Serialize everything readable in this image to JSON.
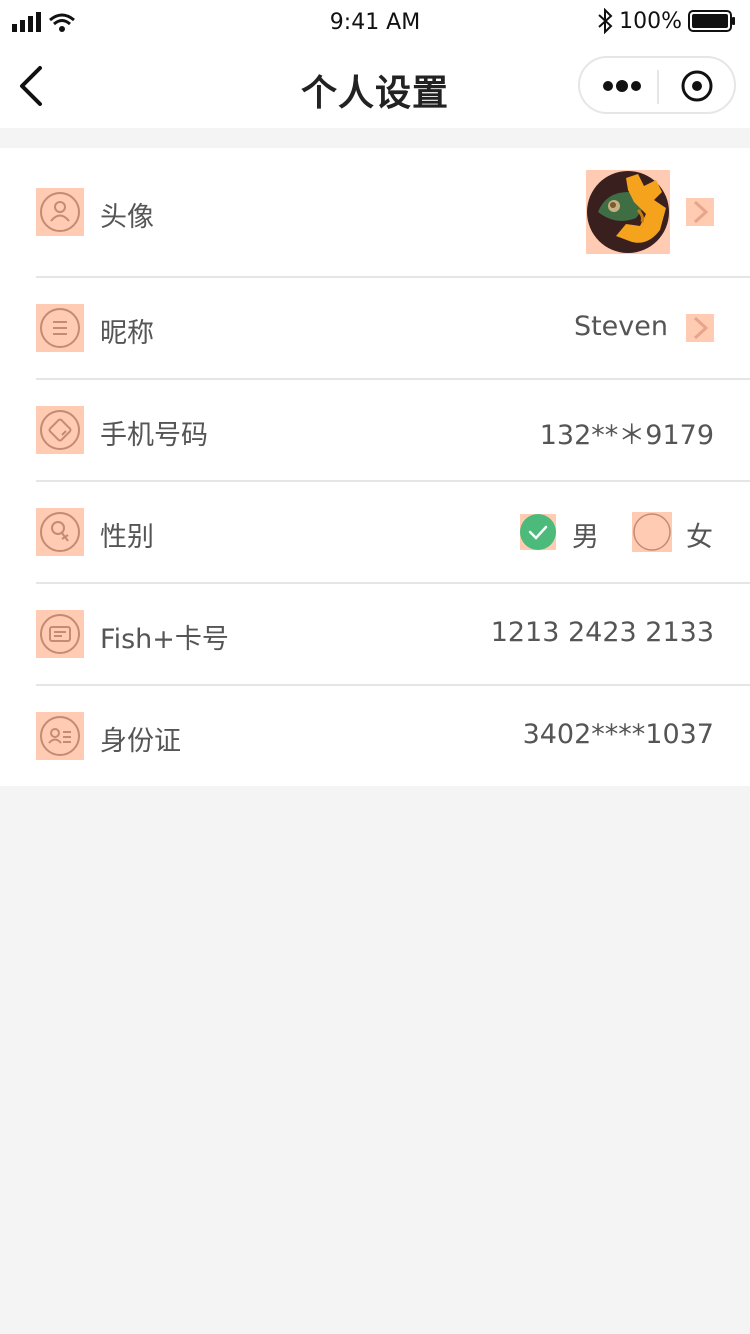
{
  "status_bar": {
    "time": "9:41 AM",
    "battery": "100%"
  },
  "nav": {
    "title": "个人设置"
  },
  "settings": {
    "avatar": {
      "label": "头像"
    },
    "nickname": {
      "label": "昵称",
      "value": "Steven"
    },
    "phone": {
      "label": "手机号码",
      "value": "132**＊9179"
    },
    "gender": {
      "label": "性别",
      "options": [
        "男",
        "女"
      ],
      "selected": "男"
    },
    "fish_card": {
      "label": "Fish+卡号",
      "value": "1213 2423 2133"
    },
    "id_card": {
      "label": "身份证",
      "value": "3402****1037"
    }
  },
  "colors": {
    "icon_highlight": "#ffcbb3",
    "icon_stroke": "#c58a72",
    "check_green": "#4cba7b",
    "separator": "#e6e6e6",
    "background": "#f4f4f4"
  }
}
